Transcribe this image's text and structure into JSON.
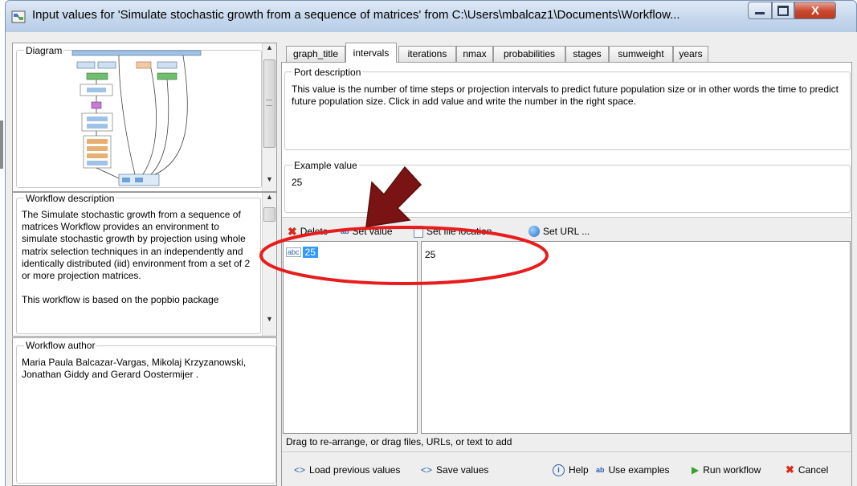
{
  "window": {
    "title": "Input values for 'Simulate stochastic growth from a sequence of matrices' from C:\\Users\\mbalcaz1\\Documents\\Workflow...",
    "close_symbol": "X"
  },
  "left": {
    "diagram_label": "Diagram",
    "description_label": "Workflow description",
    "description_text": "The Simulate stochastic growth from a sequence of matrices Workflow provides an environment to simulate stochastic growth by projection using whole matrix selection techniques in an independently and identically distributed (iid) environment from a set of 2 or more projection matrices.\n\nThis workflow is based on the popbio package",
    "author_label": "Workflow author",
    "author_text": "Maria Paula Balcazar-Vargas, Mikolaj Krzyzanowski, Jonathan Giddy and Gerard Oostermijer ."
  },
  "tabs": [
    {
      "label": "graph_title"
    },
    {
      "label": "intervals",
      "active": true
    },
    {
      "label": "iterations"
    },
    {
      "label": "nmax"
    },
    {
      "label": "probabilities"
    },
    {
      "label": "stages"
    },
    {
      "label": "sumweight"
    },
    {
      "label": "years"
    }
  ],
  "port_description": {
    "label": "Port description",
    "text": "This value is the number of time steps or projection intervals to predict future population size or in other words the time to predict future population size. Click in add value and write the number in the right space."
  },
  "example_value": {
    "label": "Example value",
    "value": "25"
  },
  "toolbar": {
    "delete": "Delete",
    "set_value": "Set value",
    "set_file_location": "Set file location...",
    "set_url": "Set URL ..."
  },
  "values_list": {
    "items": [
      {
        "type_icon": "abc",
        "value": "25"
      }
    ],
    "selected_value_display": "25"
  },
  "drag_hint": "Drag to re-arrange, or drag files, URLs, or text to add",
  "footer": {
    "load_previous": "Load previous values",
    "save_values": "Save values",
    "help": "Help",
    "use_examples": "Use examples",
    "run_workflow": "Run workflow",
    "cancel": "Cancel"
  },
  "colors": {
    "annotation_red": "#e81c1c",
    "arrow_dark_red": "#7a1414",
    "selection_blue": "#3399ff",
    "run_green": "#35a02a",
    "cancel_red": "#d62a1c"
  }
}
